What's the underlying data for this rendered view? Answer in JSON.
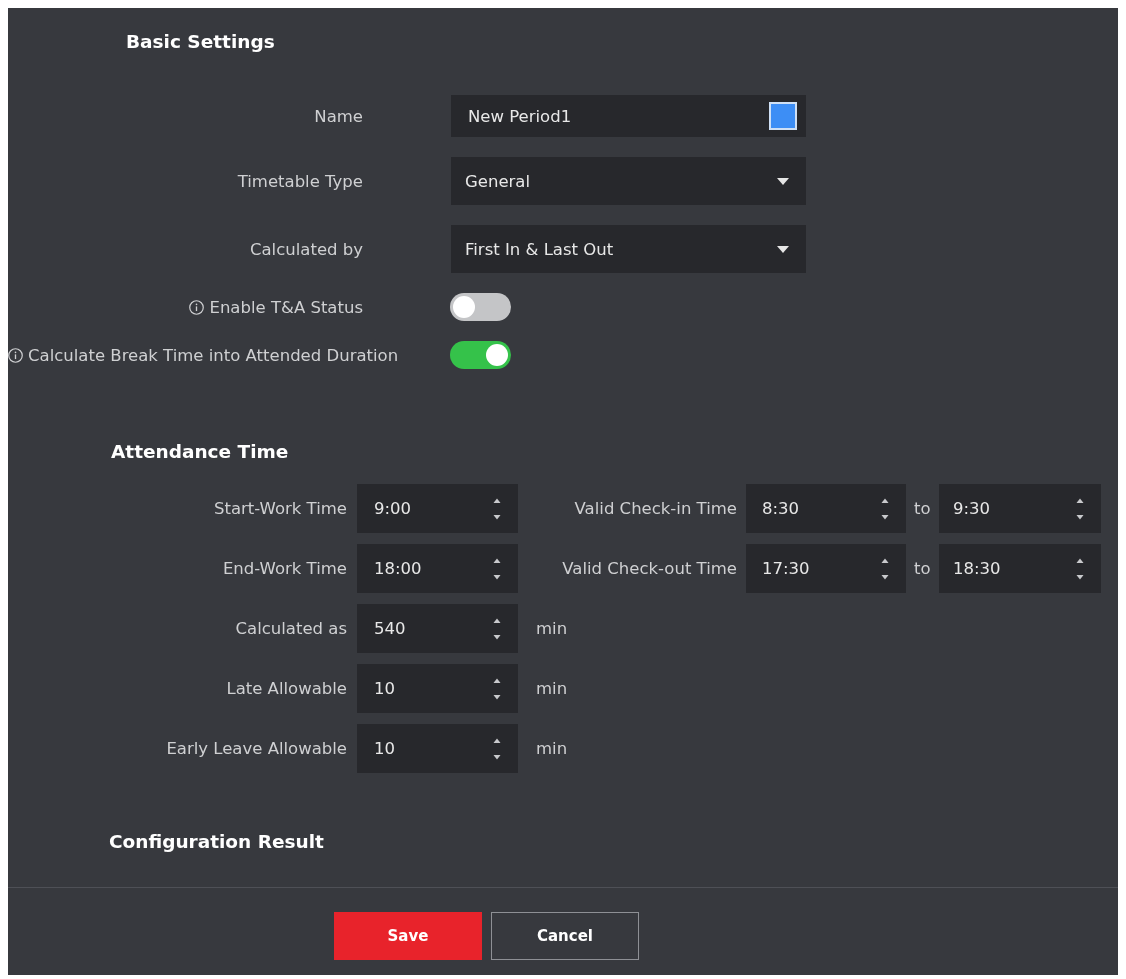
{
  "basic_settings": {
    "title": "Basic Settings",
    "fields": [
      {
        "kind": "text",
        "label": "Name",
        "value": "New Period1",
        "color": "#3d8ef5"
      },
      {
        "kind": "select",
        "label": "Timetable Type",
        "value": "General"
      },
      {
        "kind": "select",
        "label": "Calculated by",
        "value": "First In & Last Out"
      },
      {
        "kind": "toggle",
        "label": "Enable T&A Status",
        "info": true,
        "on": false
      },
      {
        "kind": "toggle",
        "label": "Calculate Break Time into Attended Duration",
        "info": true,
        "on": true
      }
    ]
  },
  "attendance_time": {
    "title": "Attendance Time",
    "rows": [
      {
        "label": "Start-Work Time",
        "value": "9:00",
        "range": {
          "label": "Valid Check-in Time",
          "from": "8:30",
          "separator": "to",
          "to": "9:30"
        }
      },
      {
        "label": "End-Work Time",
        "value": "18:00",
        "range": {
          "label": "Valid Check-out Time",
          "from": "17:30",
          "separator": "to",
          "to": "18:30"
        }
      },
      {
        "label": "Calculated as",
        "value": "540",
        "unit": "min"
      },
      {
        "label": "Late Allowable",
        "value": "10",
        "unit": "min"
      },
      {
        "label": "Early Leave Allowable",
        "value": "10",
        "unit": "min"
      }
    ]
  },
  "configuration_result": {
    "title": "Configuration Result"
  },
  "buttons": [
    {
      "label": "Save",
      "kind": "primary"
    },
    {
      "label": "Cancel",
      "kind": "secondary"
    }
  ]
}
